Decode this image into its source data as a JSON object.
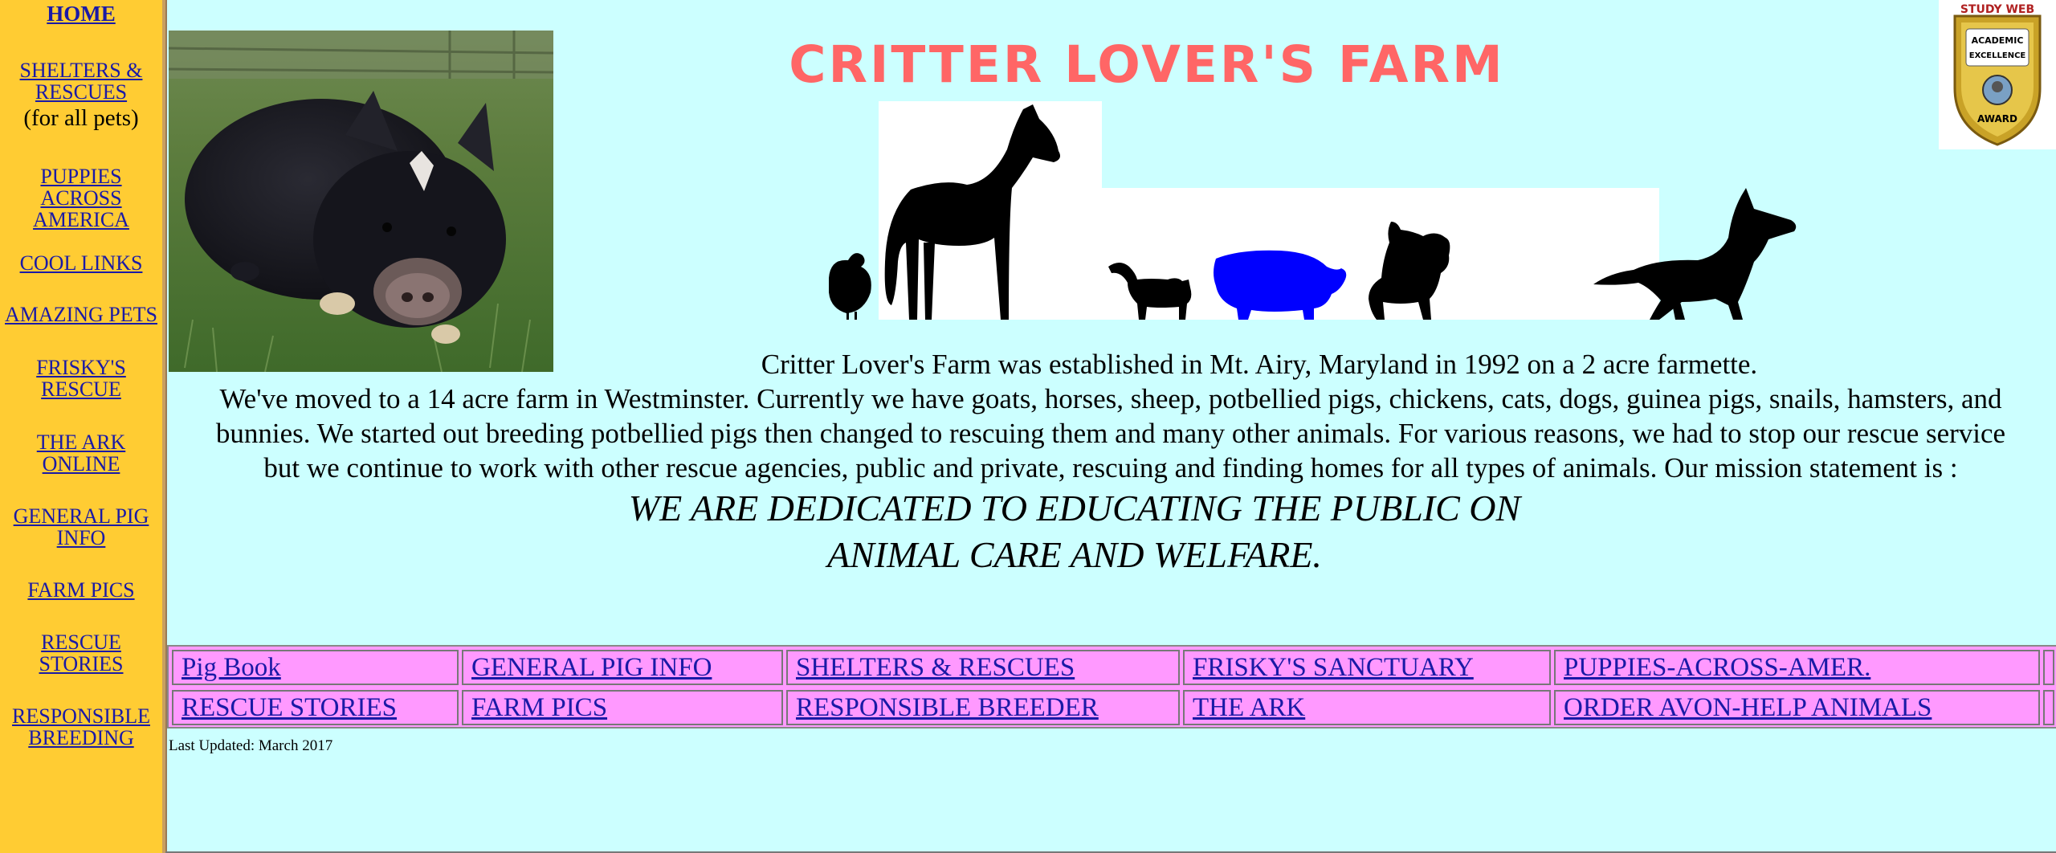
{
  "sidebar": {
    "home": "HOME",
    "shelters_l1": "SHELTERS &",
    "shelters_l2": "RESCUES",
    "shelters_note": "(for all pets)",
    "puppies_l1": "PUPPIES",
    "puppies_l2": "ACROSS",
    "puppies_l3": "AMERICA",
    "cool_links": "COOL LINKS",
    "amazing_pets": "AMAZING PETS",
    "frisky_l1": "FRISKY'S",
    "frisky_l2": "RESCUE",
    "ark_l1": "THE ARK",
    "ark_l2": "ONLINE",
    "pig_l1": "GENERAL PIG",
    "pig_l2": "INFO",
    "farm_pics": "FARM PICS",
    "rescue_l1": "RESCUE",
    "rescue_l2": "STORIES",
    "breeder_l1": "RESPONSIBLE",
    "breeder_l2": "BREEDING"
  },
  "page": {
    "title": "CRITTER LOVER'S FARM",
    "intro_line1": "Critter Lover's Farm was established in Mt. Airy, Maryland in 1992 on a 2 acre farmette.",
    "intro_line2": "We've moved to a 14 acre farm in Westminster. Currently we have goats, horses, sheep, potbellied pigs, chickens, cats, dogs, guinea pigs, snails, hamsters, and",
    "intro_line3": "bunnies. We started out breeding potbellied pigs then changed to rescuing them and many other animals.  For various reasons, we had to stop our rescue service",
    "intro_line4": "but we continue to work with other rescue agencies, public and private, rescuing and finding homes for all types of animals.  Our mission statement is :",
    "mission_l1": "WE ARE DEDICATED TO EDUCATING THE PUBLIC ON",
    "mission_l2": "ANIMAL CARE AND WELFARE.",
    "last_updated": "Last Updated: March 2017"
  },
  "award": {
    "top_text": "STUDY WEB",
    "line1": "ACADEMIC",
    "line2": "EXCELLENCE",
    "line3": "AWARD"
  },
  "nav_table": {
    "row1": [
      "Pig Book",
      "GENERAL PIG INFO",
      "SHELTERS & RESCUES",
      "FRISKY'S SANCTUARY",
      "PUPPIES-ACROSS-AMER."
    ],
    "row2": [
      "RESCUE STORIES",
      "FARM PICS",
      "RESPONSIBLE BREEDER",
      "THE ARK",
      "ORDER AVON-HELP ANIMALS"
    ]
  },
  "colors": {
    "sidebar_bg": "#ffcc33",
    "page_bg": "#ccffff",
    "title": "#ff6666",
    "link": "#1a1aa6",
    "nav_cell": "#ff99ff",
    "pig_silhouette": "#0000ff"
  }
}
